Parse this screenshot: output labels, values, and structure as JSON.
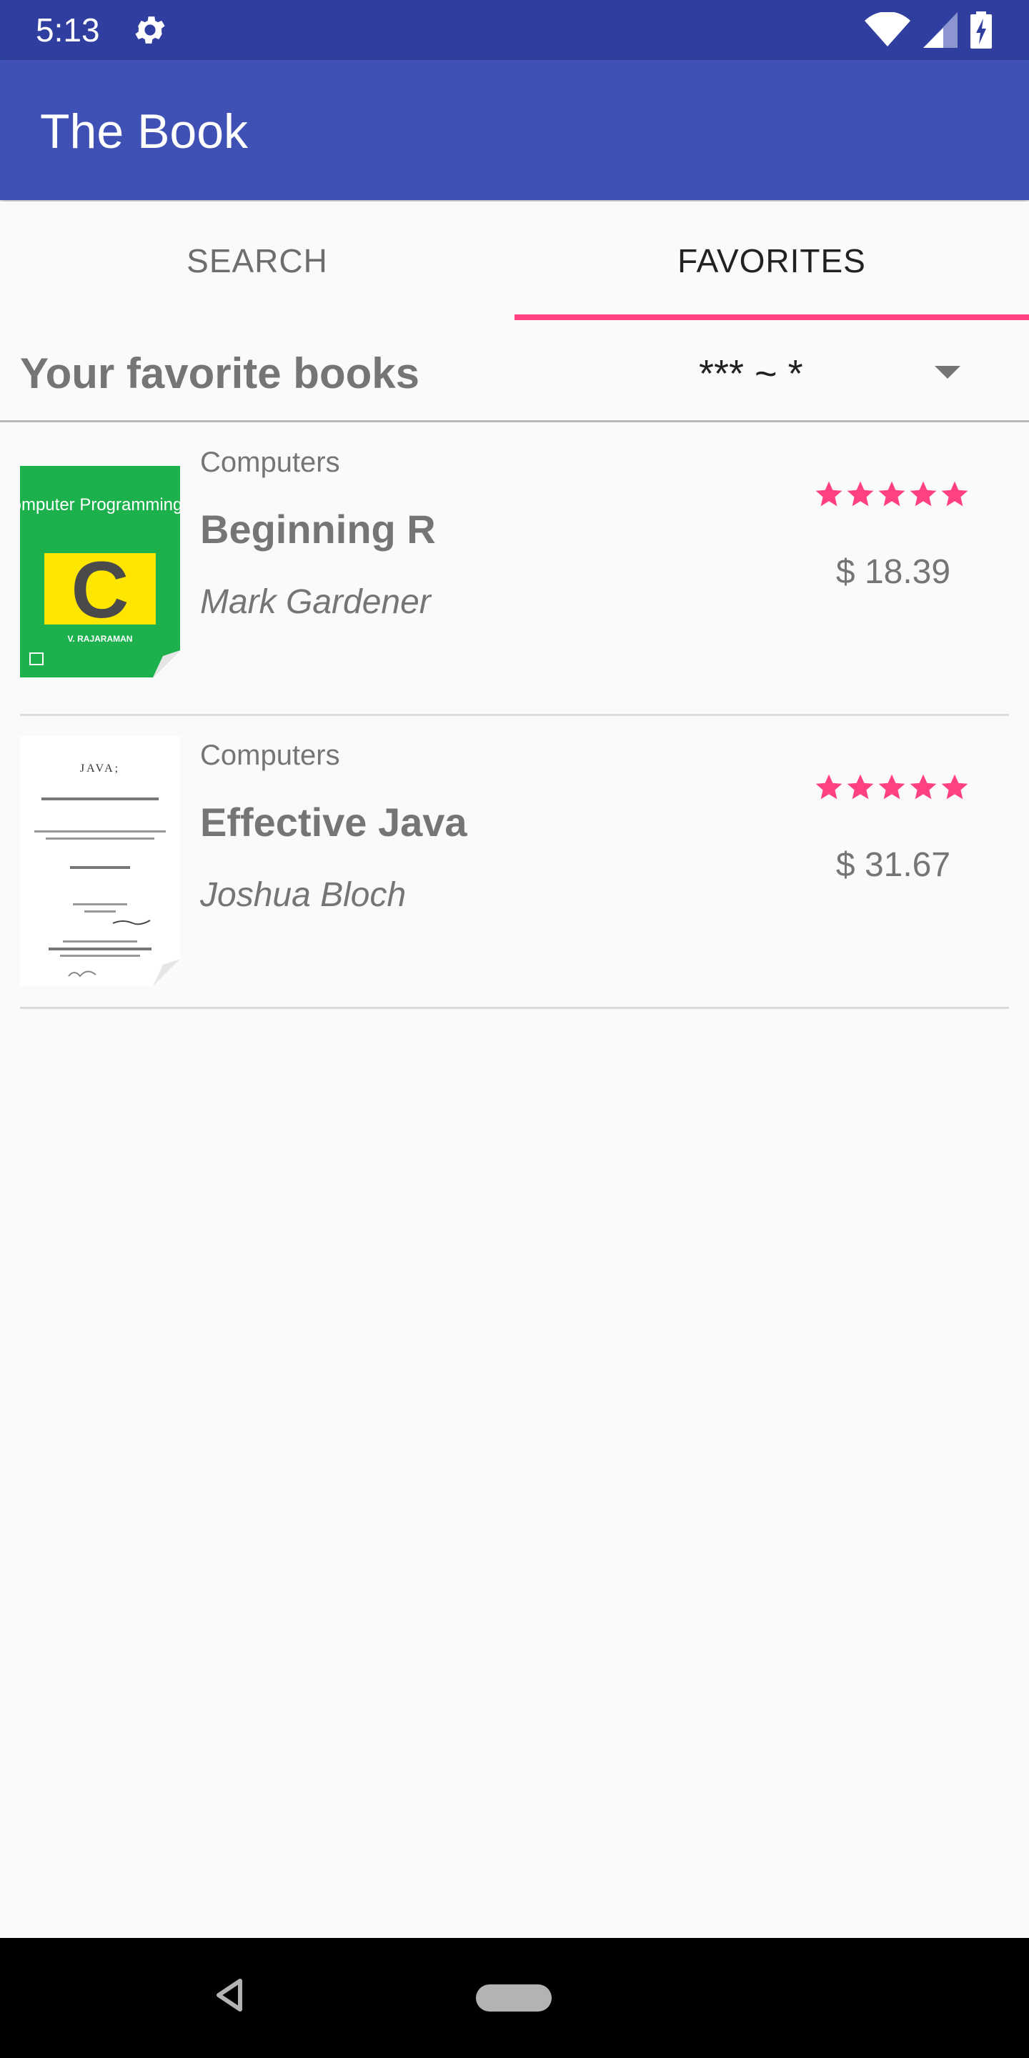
{
  "status_bar": {
    "time": "5:13",
    "icons": [
      "gear-icon",
      "wifi-icon",
      "cell-signal-icon",
      "battery-charging-icon"
    ]
  },
  "app_bar": {
    "title": "The Book"
  },
  "tabs": [
    {
      "label": "SEARCH",
      "selected": false
    },
    {
      "label": "FAVORITES",
      "selected": true
    }
  ],
  "favorites": {
    "heading": "Your favorite books",
    "rating_filter": {
      "selected_value": "*** ~ *"
    },
    "books": [
      {
        "category": "Computers",
        "title": "Beginning R",
        "author": "Mark Gardener",
        "rating": 5,
        "price": "$ 18.39",
        "cover": {
          "title_text": "Computer Programming in",
          "big_letter": "C",
          "author_text": "V. RAJARAMAN",
          "colors": {
            "background": "#1db14e",
            "panel": "#ffe600",
            "letter": "#4a4a4a"
          }
        }
      },
      {
        "category": "Computers",
        "title": "Effective Java",
        "author": "Joshua Bloch",
        "rating": 5,
        "price": "$ 31.67",
        "cover": {
          "title_text": "JAVA;",
          "colors": {
            "background": "#ffffff",
            "text": "#333333"
          }
        }
      }
    ]
  },
  "colors": {
    "primary": "#3f51b5",
    "primary_dark": "#303f9f",
    "accent": "#ff4081",
    "text_secondary": "#757575"
  },
  "nav_bar": {
    "icons": [
      "back-icon",
      "home-pill-icon"
    ]
  }
}
